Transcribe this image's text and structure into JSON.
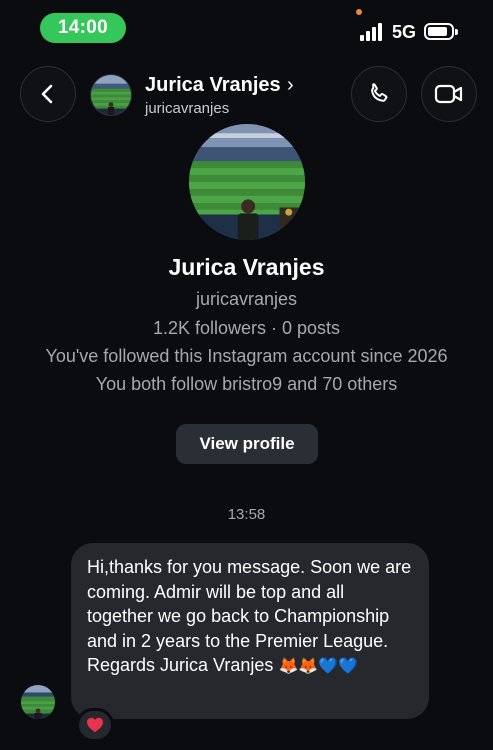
{
  "status_bar": {
    "time": "14:00",
    "network": "5G",
    "time_pill_color": "#35c759"
  },
  "header": {
    "name": "Jurica Vranjes",
    "chevron": "›",
    "handle": "juricavranjes",
    "icons": [
      "back-arrow-icon",
      "phone-icon",
      "video-camera-icon"
    ]
  },
  "profile": {
    "name": "Jurica Vranjes",
    "handle": "juricavranjes",
    "stats": "1.2K followers · 0 posts",
    "since": "You've followed this Instagram account since 2026",
    "mutual": "You both follow bristro9 and 70 others",
    "view_profile_label": "View profile"
  },
  "thread": {
    "timestamp": "13:58",
    "message_text": "Hi,thanks for you message. Soon we are coming. Admir will be top and all together we go back to Championship and in 2 years to the Premier League. Regards Jurica Vranjes",
    "message_emojis": "🦊🦊💙💙",
    "reaction_icon": "red-heart-icon"
  },
  "colors": {
    "background": "#0b0c10",
    "bubble": "#26282e",
    "button": "#2b2e35",
    "secondary_text": "#a6a9b0",
    "heart": "#e8344e"
  }
}
